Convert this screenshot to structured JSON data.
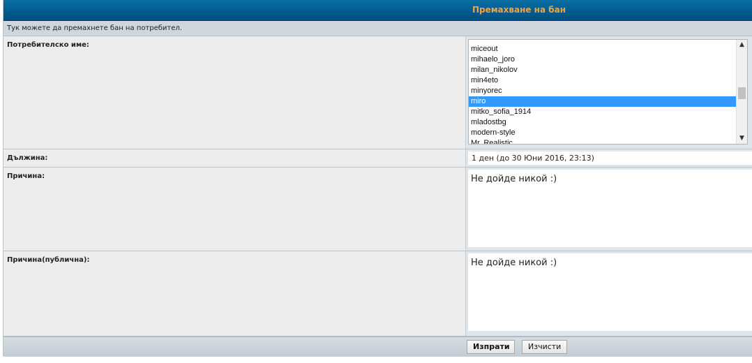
{
  "header": {
    "title": "Премахване на бан"
  },
  "description": "Тук можете да премахнете бан на потребител.",
  "fields": {
    "username": {
      "label": "Потребителско име:",
      "options": [
        "miceout",
        "mihaelo_joro",
        "milan_nikolov",
        "min4eto",
        "minyorec",
        "miro",
        "mitko_sofia_1914",
        "mladostbg",
        "modern-style",
        "Mr. Realistic"
      ],
      "selected": "miro"
    },
    "length": {
      "label": "Дължина:",
      "value": "1 ден (до 30 Юни 2016, 23:13)"
    },
    "reason": {
      "label": "Причина:",
      "value": "Не дойде никой :)"
    },
    "reason_public": {
      "label": "Причина(публична):",
      "value": "Не дойде никой :)"
    }
  },
  "buttons": {
    "submit": "Изпрати",
    "reset": "Изчисти"
  }
}
